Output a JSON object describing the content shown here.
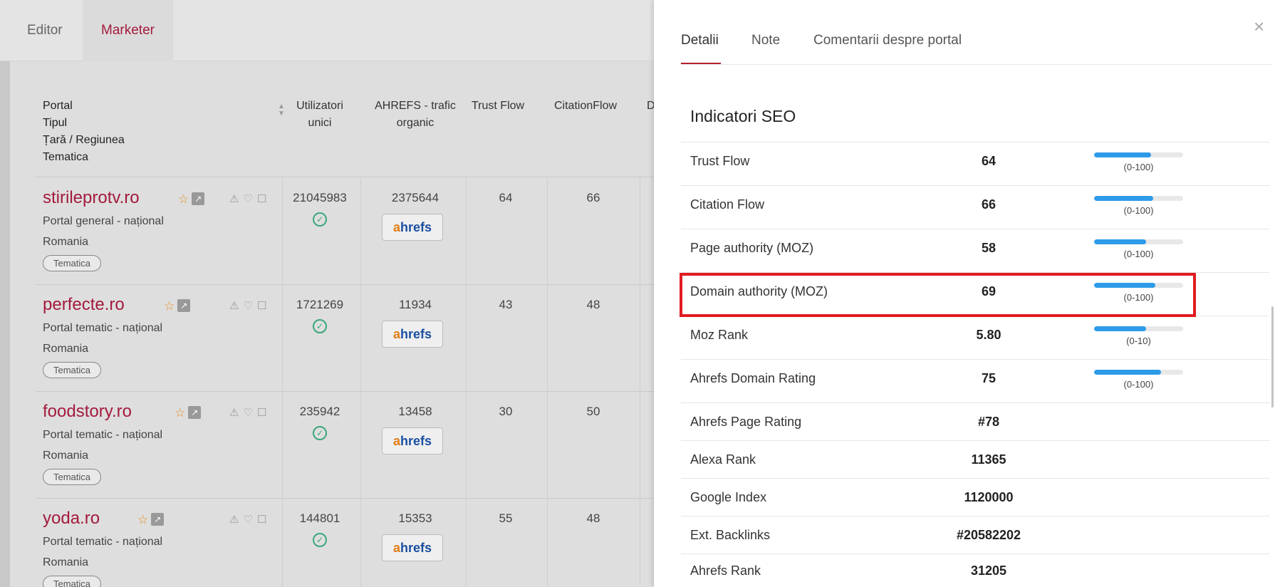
{
  "topbar": {
    "tabs": [
      "Editor",
      "Marketer"
    ]
  },
  "table": {
    "header": {
      "portal_lines": [
        "Portal",
        "Tipul",
        "Țară / Regiunea",
        "Tematica"
      ],
      "col_users": "Utilizatori unici",
      "col_ahrefs": "AHREFS - trafic organic",
      "col_trust": "Trust Flow",
      "col_citation": "CitationFlow",
      "col_d": "D"
    },
    "rows": [
      {
        "site": "stirileprotv.ro",
        "type": "Portal general - național",
        "country": "Romania",
        "tag": "Tematica",
        "users": "21045983",
        "traffic": "2375644",
        "trust": "64",
        "citation": "66"
      },
      {
        "site": "perfecte.ro",
        "type": "Portal tematic - național",
        "country": "Romania",
        "tag": "Tematica",
        "users": "1721269",
        "traffic": "11934",
        "trust": "43",
        "citation": "48"
      },
      {
        "site": "foodstory.ro",
        "type": "Portal tematic - național",
        "country": "Romania",
        "tag": "Tematica",
        "users": "235942",
        "traffic": "13458",
        "trust": "30",
        "citation": "50"
      },
      {
        "site": "yoda.ro",
        "type": "Portal tematic - național",
        "country": "Romania",
        "tag": "Tematica",
        "users": "144801",
        "traffic": "15353",
        "trust": "55",
        "citation": "48"
      }
    ],
    "ahrefs_badge": {
      "a": "a",
      "rest": "hrefs"
    }
  },
  "drawer": {
    "tabs": [
      "Detalii",
      "Note",
      "Comentarii despre portal"
    ],
    "close_label": "×",
    "section_title": "Indicatori SEO",
    "indicators": [
      {
        "label": "Trust Flow",
        "value": "64",
        "level": 0.64,
        "range": "(0-100)"
      },
      {
        "label": "Citation Flow",
        "value": "66",
        "level": 0.66,
        "range": "(0-100)"
      },
      {
        "label": "Page authority (MOZ)",
        "value": "58",
        "level": 0.58,
        "range": "(0-100)"
      },
      {
        "label": "Domain authority (MOZ)",
        "value": "69",
        "level": 0.69,
        "range": "(0-100)"
      },
      {
        "label": "Moz Rank",
        "value": "5.80",
        "level": 0.58,
        "range": "(0-10)"
      },
      {
        "label": "Ahrefs Domain Rating",
        "value": "75",
        "level": 0.75,
        "range": "(0-100)"
      },
      {
        "label": "Ahrefs Page Rating",
        "value": "#78"
      },
      {
        "label": "Alexa Rank",
        "value": "11365"
      },
      {
        "label": "Google Index",
        "value": "1120000"
      },
      {
        "label": "Ext. Backlinks",
        "value": "#20582202"
      },
      {
        "label": "Ahrefs Rank",
        "value": "31205"
      }
    ],
    "highlighted_indicator": "Domain authority (MOZ)"
  },
  "colors": {
    "brand": "#a31a3c",
    "bar": "#2e9be8",
    "highlight": "#e11b22",
    "check": "#3aa77a"
  }
}
